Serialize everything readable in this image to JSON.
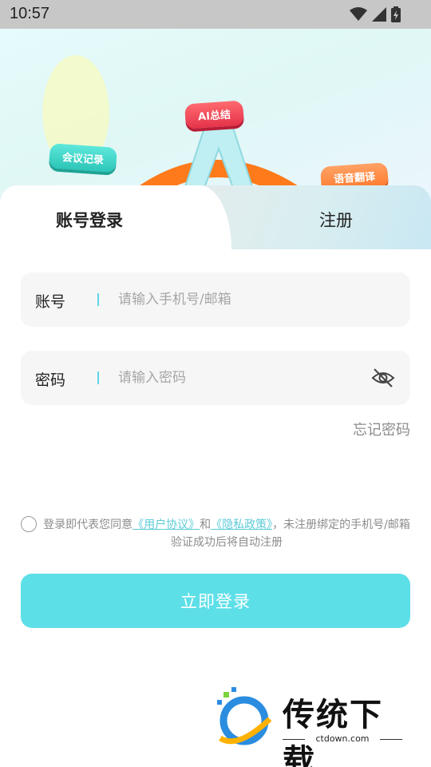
{
  "status_bar": {
    "time": "10:57"
  },
  "hero": {
    "pills": {
      "meeting": "会议记录",
      "ai": "AI总结",
      "voice": "语音翻译"
    },
    "logo_letter": "A"
  },
  "tabs": {
    "login": "账号登录",
    "register": "注册"
  },
  "form": {
    "account": {
      "label": "账号",
      "placeholder": "请输入手机号/邮箱",
      "value": ""
    },
    "password": {
      "label": "密码",
      "placeholder": "请输入密码",
      "value": ""
    },
    "forgot": "忘记密码"
  },
  "agreement": {
    "checked": false,
    "prefix": "登录即代表您同意",
    "user_agreement": "《用户协议》",
    "and": "和",
    "privacy_policy": "《隐私政策》",
    "suffix": "，未注册绑定的手机号/邮箱验证成功后将自动注册"
  },
  "login_button": "立即登录",
  "watermark": {
    "title": "传统下载",
    "url": "ctdown.com"
  },
  "colors": {
    "accent": "#5ddfe8",
    "link": "#5bcbd9",
    "field_bg": "#f6f6f6"
  }
}
